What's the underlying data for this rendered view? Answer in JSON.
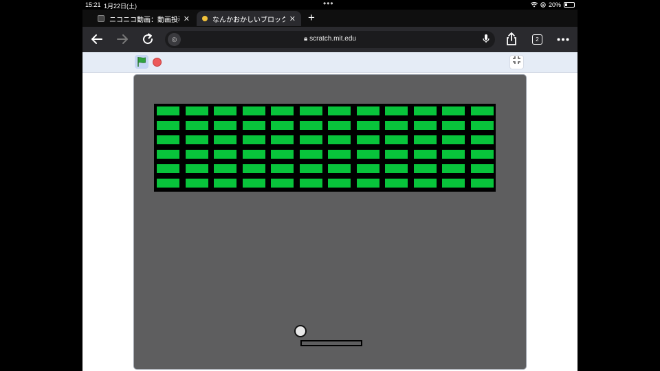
{
  "status_bar": {
    "time": "15:21",
    "date": "1月22日(土)",
    "battery": "20%"
  },
  "tabs": [
    {
      "title": "ニコニコ動画：動画投稿",
      "active": false
    },
    {
      "title": "なんかおかしいブロック崩し",
      "active": true
    }
  ],
  "icons": {
    "new_tab": "plus-icon",
    "back": "back-arrow-icon",
    "forward": "forward-arrow-icon",
    "reload": "reload-icon",
    "share": "share-icon",
    "more": "more-icon",
    "mic": "microphone-icon",
    "lock": "lock-icon",
    "green_flag": "green-flag-icon",
    "stop": "stop-icon",
    "exit_fullscreen": "exit-fullscreen-icon"
  },
  "toolbar": {
    "url": "scratch.mit.edu",
    "tab_count": "2"
  },
  "game": {
    "brick_rows": 6,
    "brick_columns": 12,
    "colors": {
      "stage": "#5e5e5f",
      "brick": "#08c43b",
      "wall": "#000000",
      "ball": "#e8e8e8",
      "header": "#e5ecf6",
      "stop": "#ec5959",
      "flag": "#2fa33f"
    }
  }
}
